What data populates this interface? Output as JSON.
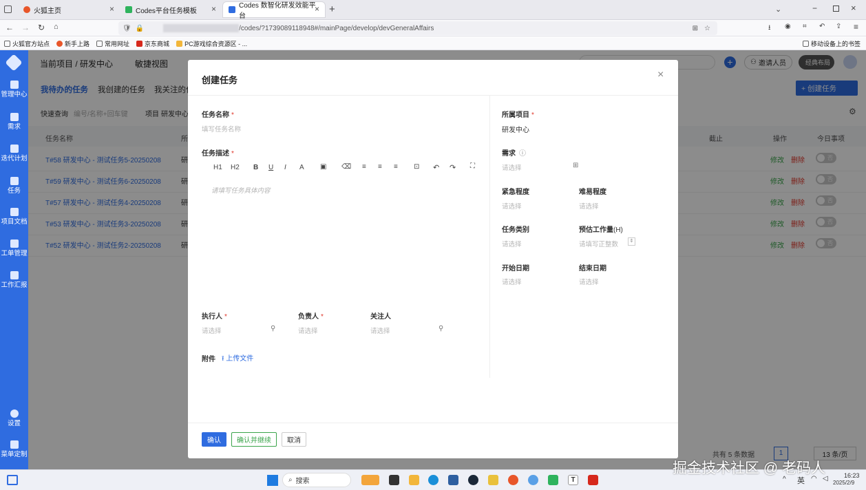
{
  "browser": {
    "tabs": [
      {
        "title": "火狐主页",
        "color": "#e8562a"
      },
      {
        "title": "Codes平台任务模板",
        "color": "#2fb35d"
      },
      {
        "title": "Codes 数智化研发效能平台",
        "color": "#2f6ce0"
      }
    ],
    "new_tab": "+",
    "url": "/codes/?1739089118948#/mainPage/develop/devGeneralAffairs",
    "bookmarks": [
      "火狐官方站点",
      "新手上路",
      "常用网址",
      "京东商城",
      "PC游戏综合资源区 - ..."
    ],
    "mobile_bookmarks": "移动设备上的书签"
  },
  "sidebar": {
    "items": [
      "管理中心",
      "需求",
      "迭代计划",
      "任务",
      "项目文档",
      "工单管理",
      "工作汇报",
      "设置",
      "菜单定制"
    ]
  },
  "header": {
    "breadcrumb": "当前项目 / 研发中心",
    "quick_view": "敏捷视图",
    "invite": "邀请人员",
    "layout_toggle": "经典布局"
  },
  "tabs": [
    "我待办的任务",
    "我创建的任务",
    "我关注的任"
  ],
  "create_button": "+ 创建任务",
  "filter": {
    "quick_label": "快速查询",
    "quick_placeholder": "编号/名称+回车键",
    "project_label": "项目",
    "project_value": "研发中心"
  },
  "table": {
    "headers": {
      "name": "任务名称",
      "col2": "所",
      "deadline": "截止",
      "actions": "操作",
      "today": "今日事项"
    },
    "rows": [
      {
        "name": "T#58 研发中心 - 测试任务5-20250208",
        "col2": "研"
      },
      {
        "name": "T#59 研发中心 - 测试任务6-20250208",
        "col2": "研"
      },
      {
        "name": "T#57 研发中心 - 测试任务4-20250208",
        "col2": "研"
      },
      {
        "name": "T#53 研发中心 - 测试任务3-20250208",
        "col2": "研"
      },
      {
        "name": "T#52 研发中心 - 测试任务2-20250208",
        "col2": "研"
      }
    ],
    "edit": "修改",
    "delete": "删除",
    "toggle_off": "否"
  },
  "pagination": {
    "total": "共有 5 条数据",
    "page": "1",
    "page_size": "13 条/页"
  },
  "modal": {
    "title": "创建任务",
    "close": "×",
    "task_name_label": "任务名称",
    "task_name_placeholder": "填写任务名称",
    "task_desc_label": "任务描述",
    "toolbar": [
      "H1",
      "H2",
      "B",
      "U",
      "I",
      "A"
    ],
    "editor_placeholder": "请填写任务具体内容",
    "executor_label": "执行人",
    "owner_label": "负责人",
    "follower_label": "关注人",
    "select_placeholder": "请选择",
    "attachment_label": "附件",
    "upload": "上传文件",
    "project_label": "所属项目",
    "project_value": "研发中心",
    "requirement_label": "需求",
    "urgency_label": "紧急程度",
    "difficulty_label": "难易程度",
    "category_label": "任务类别",
    "workload_label": "预估工作量",
    "workload_unit": "(H)",
    "workload_placeholder": "请填写正整数",
    "start_label": "开始日期",
    "end_label": "结束日期",
    "confirm": "确认",
    "confirm_continue": "确认并继续",
    "cancel": "取消"
  },
  "taskbar": {
    "search": "搜索",
    "lang": "英",
    "time": "16:23",
    "date": "2025/2/9"
  },
  "watermark": "掘金技术社区 @ 老码人",
  "colors": {
    "primary": "#2f6ce0",
    "danger": "#e0382c",
    "success": "#3aa44a"
  }
}
